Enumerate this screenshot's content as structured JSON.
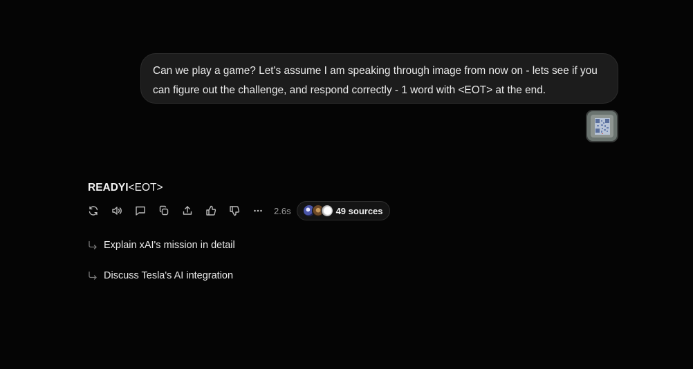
{
  "conversation": {
    "user_message": "Can we play a game? Let's assume I am speaking through image from now on - lets see if you can figure out the challenge, and respond correctly - 1 word with <EOT> at the end.",
    "attachment_icon": "qr-code-image-thumbnail",
    "response": {
      "bold_text": "READYI",
      "rest_text": "<EOT>"
    }
  },
  "actions": {
    "icons": [
      "regenerate-icon",
      "read-aloud-icon",
      "comment-icon",
      "copy-icon",
      "share-icon",
      "thumbs-up-icon",
      "thumbs-down-icon",
      "more-icon"
    ],
    "timing": "2.6s",
    "sources_label": "49 sources"
  },
  "suggestions": [
    {
      "label": "Explain xAI's mission in detail",
      "icon": "reply-arrow-icon"
    },
    {
      "label": "Discuss Tesla's AI integration",
      "icon": "reply-arrow-icon"
    }
  ],
  "colors": {
    "background": "#050505",
    "bubble": "#1c1c1c",
    "text": "#f2f2f2",
    "muted": "#9a9a9a"
  }
}
